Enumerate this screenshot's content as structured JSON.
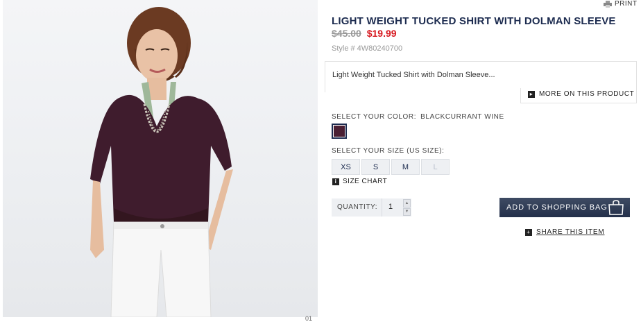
{
  "print_label": "PRINT",
  "product": {
    "title": "LIGHT WEIGHT TUCKED SHIRT WITH DOLMAN SLEEVE",
    "price_original": "$45.00",
    "price_sale": "$19.99",
    "style_number": "Style # 4W80240700",
    "description": "Light Weight Tucked Shirt with Dolman Sleeve...",
    "more_link": "MORE ON THIS PRODUCT"
  },
  "color": {
    "label": "SELECT YOUR COLOR:",
    "selected": "BLACKCURRANT WINE",
    "swatch_hex": "#4a1f33"
  },
  "size": {
    "label": "SELECT YOUR SIZE (US SIZE):",
    "options": [
      {
        "label": "XS",
        "available": true
      },
      {
        "label": "S",
        "available": true
      },
      {
        "label": "M",
        "available": true
      },
      {
        "label": "L",
        "available": false
      }
    ],
    "chart_link": "SIZE CHART"
  },
  "quantity": {
    "label": "QUANTITY:",
    "value": "1"
  },
  "actions": {
    "add_to_bag": "ADD TO SHOPPING BAG",
    "share": "SHARE THIS ITEM"
  },
  "photo_caption_fragment": "01",
  "colors": {
    "navy": "#1c2b4f",
    "sale_red": "#d71920",
    "button_dark": "#24304a"
  }
}
